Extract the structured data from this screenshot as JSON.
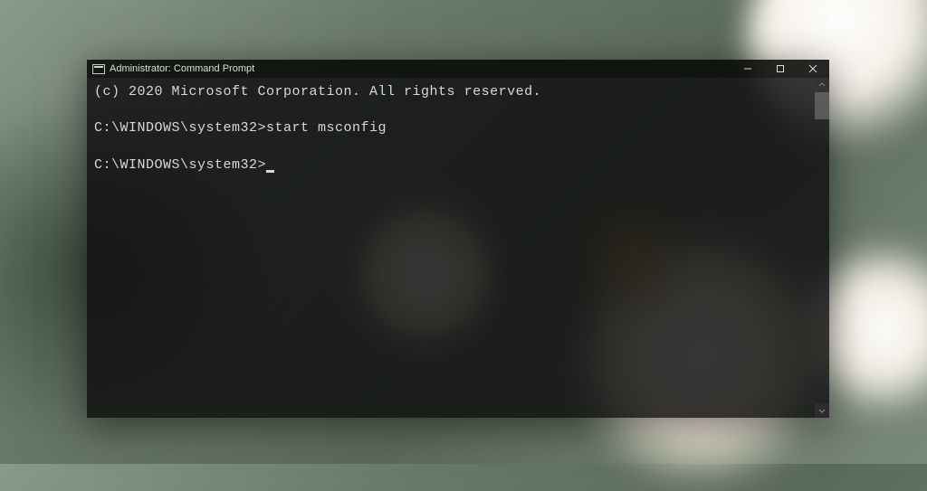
{
  "window": {
    "title": "Administrator: Command Prompt"
  },
  "terminal": {
    "line1": "(c) 2020 Microsoft Corporation. All rights reserved.",
    "prompt1": "C:\\WINDOWS\\system32>",
    "command1": "start msconfig",
    "prompt2": "C:\\WINDOWS\\system32>"
  }
}
